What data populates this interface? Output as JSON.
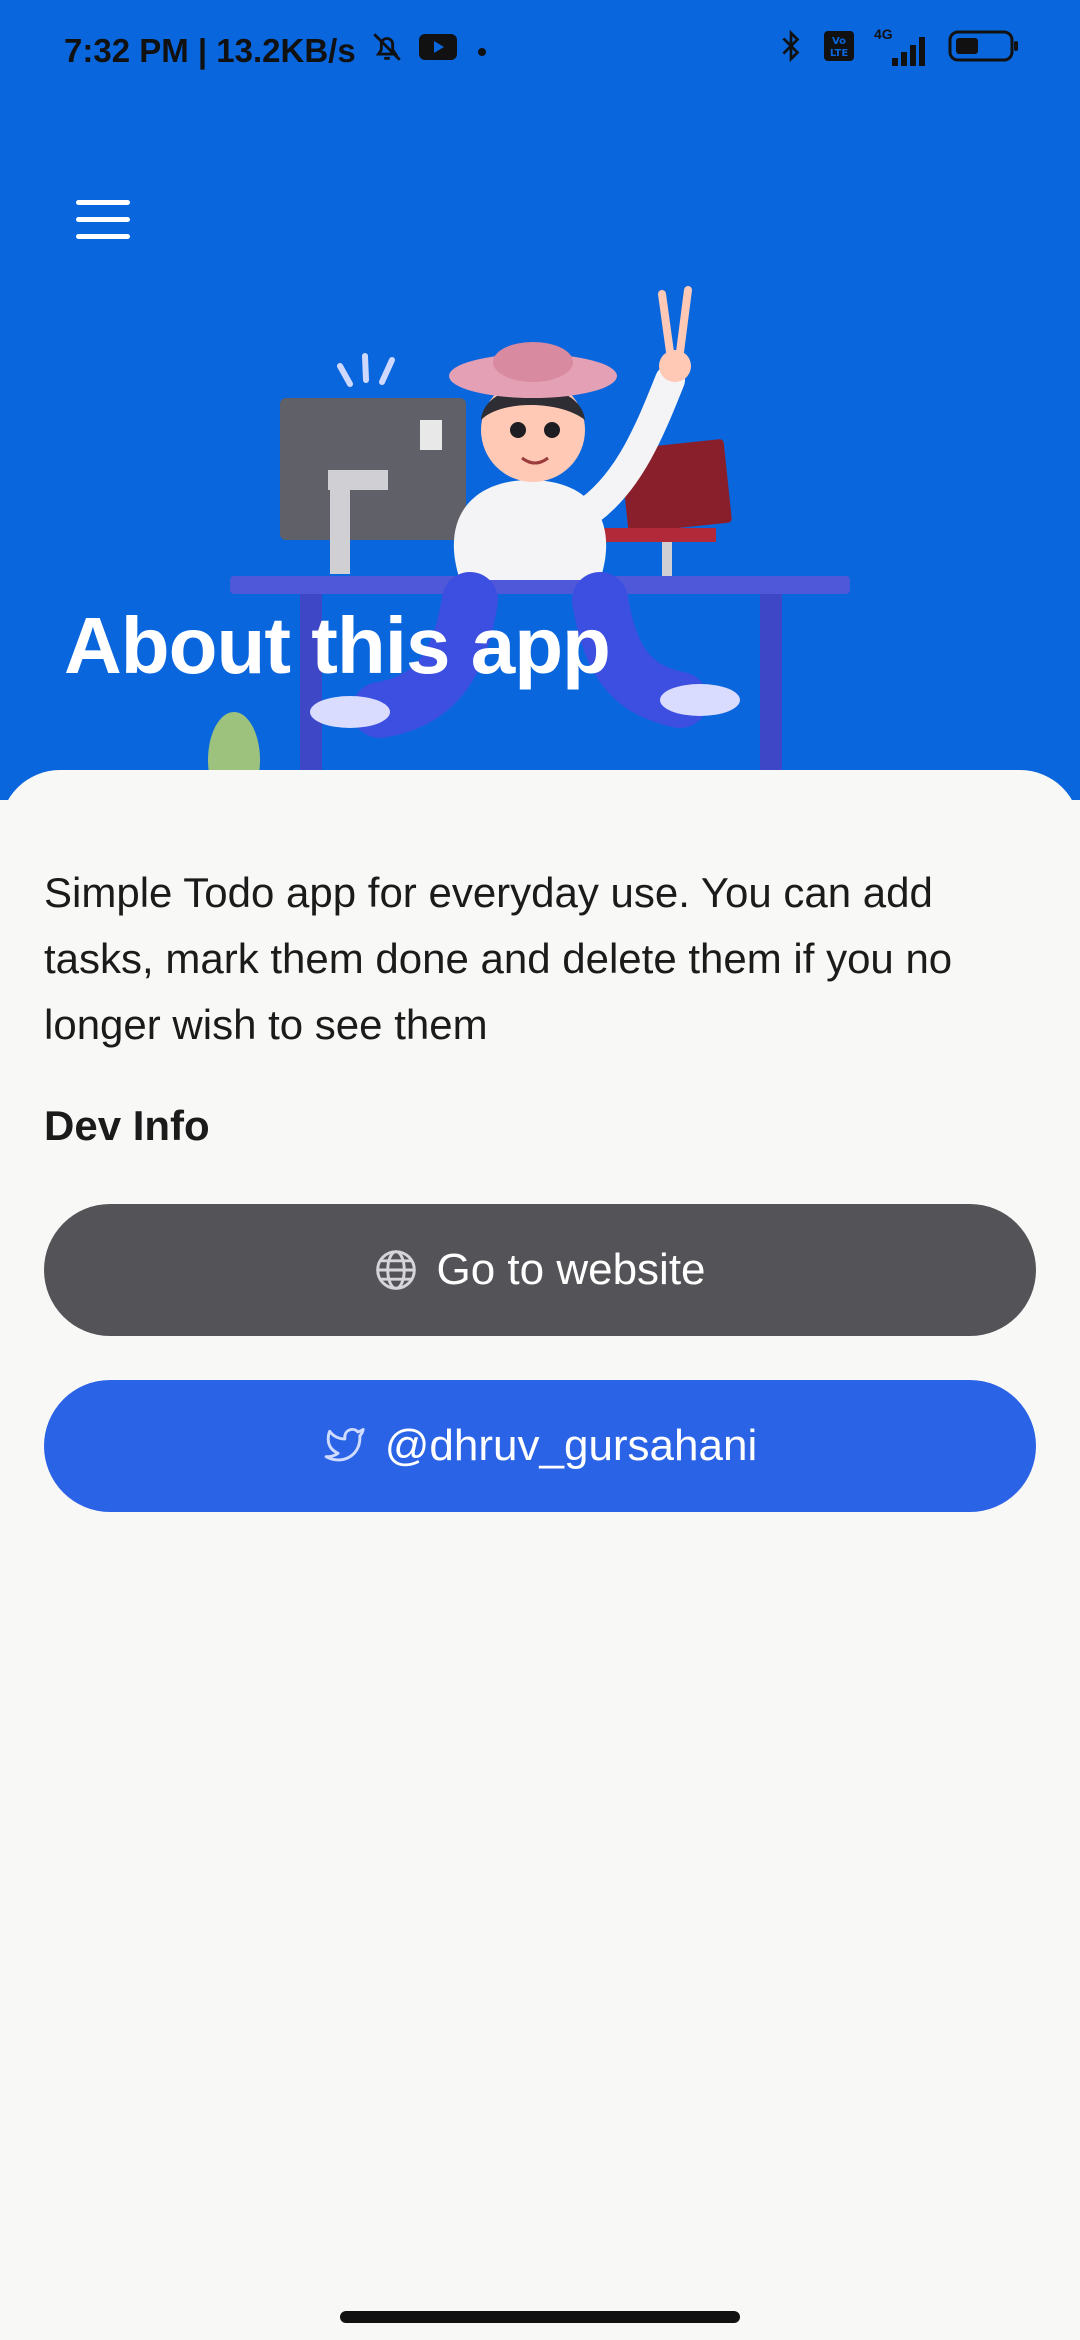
{
  "status_bar": {
    "time_speed": "7:32 PM | 13.2KB/s",
    "icons": [
      "mute-icon",
      "youtube-icon",
      "dot-icon",
      "bluetooth-icon",
      "volte-icon",
      "signal-4g-icon",
      "battery-icon"
    ],
    "network_label": "4G"
  },
  "header": {
    "menu_icon": "hamburger-menu-icon",
    "title": "About this app"
  },
  "content": {
    "description": "Simple Todo app for everyday use. You can add tasks, mark them done and delete them if you no longer wish to see them",
    "dev_info_heading": "Dev Info",
    "website_button": {
      "label": "Go to website",
      "icon": "globe-icon"
    },
    "twitter_button": {
      "label": "@dhruv_gursahani",
      "icon": "twitter-icon"
    }
  },
  "colors": {
    "hero_background": "#0a66dc",
    "website_button": "#545458",
    "twitter_button": "#2b63e6",
    "sheet_background": "#f8f8f6"
  }
}
